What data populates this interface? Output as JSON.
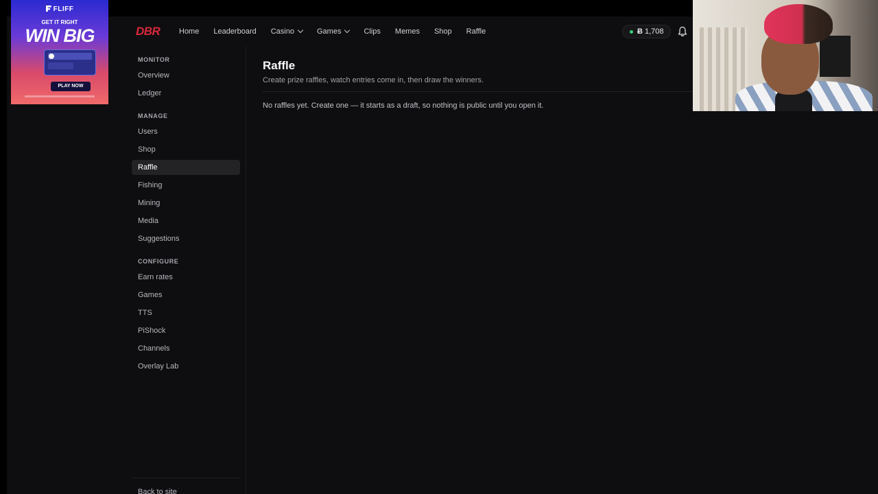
{
  "ad": {
    "brand": "FLIFF",
    "tagline": "GET IT RIGHT",
    "headline": "WIN BIG",
    "cta": "PLAY NOW"
  },
  "nav": {
    "logo": "DBR",
    "links": [
      "Home",
      "Leaderboard",
      "Casino",
      "Games",
      "Clips",
      "Memes",
      "Shop",
      "Raffle"
    ],
    "balance_symbol": "Ƀ",
    "balance_value": "1,708",
    "status_color": "#3ad07a",
    "bell_icon": "bell-icon"
  },
  "sidebar": {
    "sections": [
      {
        "title": "MONITOR",
        "items": [
          "Overview",
          "Ledger"
        ]
      },
      {
        "title": "MANAGE",
        "items": [
          "Users",
          "Shop",
          "Raffle",
          "Fishing",
          "Mining",
          "Media",
          "Suggestions"
        ]
      },
      {
        "title": "CONFIGURE",
        "items": [
          "Earn rates",
          "Games",
          "TTS",
          "PiShock",
          "Channels",
          "Overlay Lab"
        ]
      }
    ],
    "active_item": "Raffle",
    "back_link": "Back to site"
  },
  "main": {
    "title": "Raffle",
    "subtitle": "Create prize raffles, watch entries come in, then draw the winners.",
    "empty_message": "No raffles yet. Create one — it starts as a draft, so nothing is public until you open it."
  },
  "colors": {
    "background": "#0e0e10",
    "brand_red": "#d8283a",
    "active_bg": "#232326"
  }
}
